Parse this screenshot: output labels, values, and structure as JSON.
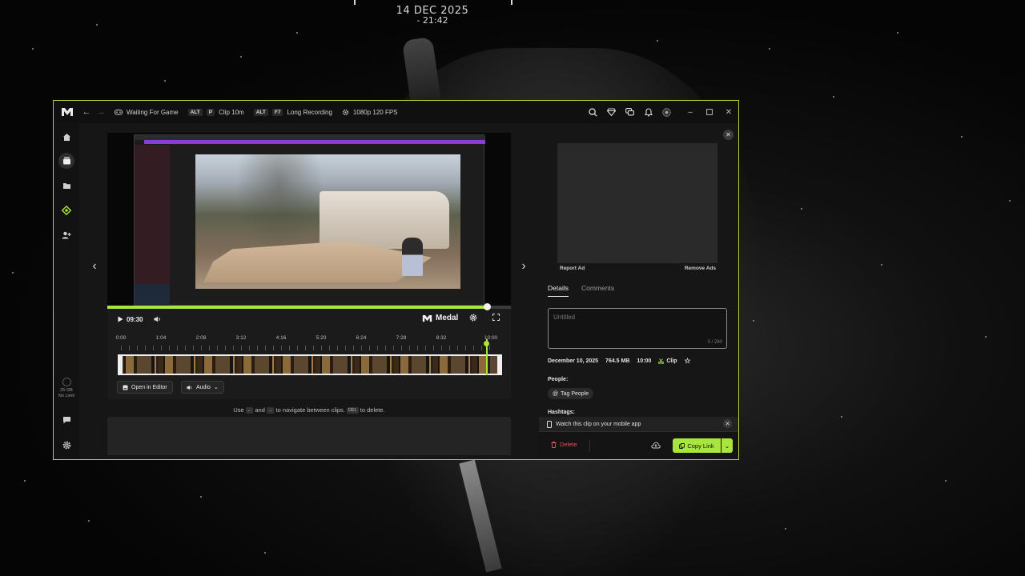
{
  "desktop": {
    "date": "14 DEC 2025",
    "time": "- 21:42"
  },
  "titlebar": {
    "status": "Waiting For Game",
    "hotkey1_mod": "ALT",
    "hotkey1_key": "P",
    "hotkey1_label": "Clip 10m",
    "hotkey2_mod": "ALT",
    "hotkey2_key": "F7",
    "hotkey2_label": "Long Recording",
    "quality": "1080p 120 FPS"
  },
  "sidebar": {
    "storage_size": "25 GB",
    "storage_limit": "No Limit"
  },
  "player": {
    "current_time": "09:30",
    "brand": "Medal",
    "progress_fraction": 0.94,
    "timeline_labels": [
      "0:00",
      "1:04",
      "2:08",
      "3:12",
      "4:16",
      "5:20",
      "6:24",
      "7:28",
      "8:32",
      "10:00"
    ],
    "open_editor_label": "Open in Editor",
    "audio_label": "Audio",
    "hint_prefix": "Use",
    "hint_key_left": "←",
    "hint_and": "and",
    "hint_key_right": "→",
    "hint_mid": "to navigate between clips.",
    "hint_key_del": "DEL",
    "hint_suffix": "to delete."
  },
  "panel": {
    "report_ad": "Report Ad",
    "remove_ads": "Remove Ads",
    "tabs": [
      "Details",
      "Comments"
    ],
    "title_placeholder": "Untitled",
    "char_count": "0 / 280",
    "date": "December 10, 2025",
    "size": "764.5 MB",
    "duration": "10:00",
    "type": "Clip",
    "people_label": "People:",
    "tag_people": "Tag People",
    "hashtags_label": "Hashtags:",
    "mobile_banner": "Watch this clip on your mobile app",
    "delete_label": "Delete",
    "copy_link_label": "Copy Link"
  },
  "colors": {
    "accent": "#a9e53f",
    "window_border": "#b8cc3a",
    "danger": "#e0505a"
  }
}
